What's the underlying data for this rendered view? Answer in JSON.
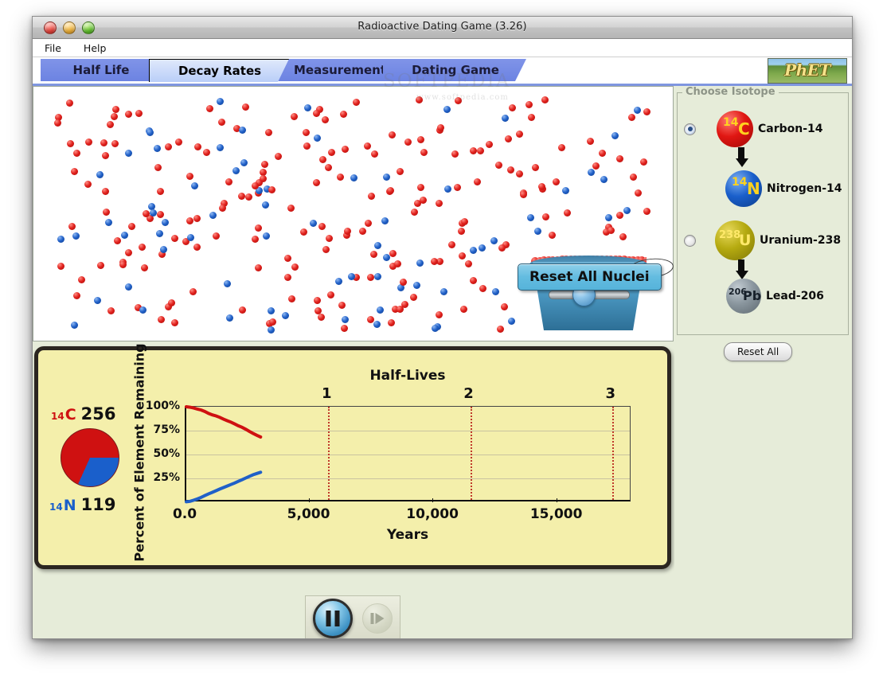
{
  "window": {
    "title": "Radioactive Dating Game (3.26)",
    "traffic_lights": [
      "close-red",
      "minimize-yellow",
      "zoom-green"
    ]
  },
  "menubar": {
    "items": [
      "File",
      "Help"
    ]
  },
  "tabs": [
    {
      "label": "Half Life",
      "active": false
    },
    {
      "label": "Decay Rates",
      "active": true
    },
    {
      "label": "Measurement",
      "active": false
    },
    {
      "label": "Dating Game",
      "active": false
    }
  ],
  "logo": {
    "text": "PhET"
  },
  "watermark": {
    "text": "SOFTPEDIA",
    "sub": "www.softpedia.com"
  },
  "canvas": {
    "reset_nuclei_label": "Reset All Nuclei",
    "bucket_name": "nuclei-bucket"
  },
  "isotope_panel": {
    "legend": "Choose Isotope",
    "options": [
      {
        "selected": true,
        "parent": {
          "mass": "14",
          "symbol": "C",
          "label": "Carbon-14",
          "color": "#e01612"
        },
        "daughter": {
          "mass": "14",
          "symbol": "N",
          "label": "Nitrogen-14",
          "color": "#1a5fcb"
        }
      },
      {
        "selected": false,
        "parent": {
          "mass": "238",
          "symbol": "U",
          "label": "Uranium-238",
          "color": "#b5aa10"
        },
        "daughter": {
          "mass": "206",
          "symbol": "Pb",
          "label": "Lead-206",
          "color": "#8b979f"
        }
      }
    ],
    "reset_all_label": "Reset All"
  },
  "counts": {
    "parent": {
      "mass": "14",
      "symbol": "C",
      "value": "256"
    },
    "daughter": {
      "mass": "14",
      "symbol": "N",
      "value": "119"
    }
  },
  "controls": {
    "play_pause": "pause",
    "step": "step-forward",
    "step_enabled": false
  },
  "chart_data": {
    "type": "line",
    "title": "Half-Lives",
    "xlabel": "Years",
    "ylabel": "Percent of Element Remaining",
    "xlim": [
      0,
      18000
    ],
    "ylim": [
      0,
      100
    ],
    "xticks": [
      0,
      5000,
      10000,
      15000
    ],
    "xticklabels": [
      "0.0",
      "5,000",
      "10,000",
      "15,000"
    ],
    "yticks": [
      25,
      50,
      75,
      100
    ],
    "yticklabels": [
      "25%",
      "50%",
      "75%",
      "100%"
    ],
    "grid": true,
    "legend": "none",
    "half_life_years": 5730,
    "half_life_markers": [
      {
        "label": "1",
        "years": 5730
      },
      {
        "label": "2",
        "years": 11460
      },
      {
        "label": "3",
        "years": 17190
      }
    ],
    "series": [
      {
        "name": "Carbon-14",
        "color": "#cf1111",
        "x": [
          0,
          150,
          300,
          450,
          600,
          750,
          900,
          1050,
          1200,
          1350,
          1500,
          1650,
          1800,
          1950,
          2100,
          2250,
          2400,
          2550,
          2700,
          2850,
          3000
        ],
        "y": [
          100,
          99.5,
          98.7,
          97.5,
          96.6,
          95.0,
          93.0,
          91.5,
          90.4,
          88.9,
          87.0,
          85.4,
          83.9,
          82.0,
          80.1,
          78.5,
          76.4,
          74.2,
          72.0,
          70.1,
          68.3
        ]
      },
      {
        "name": "Nitrogen-14",
        "color": "#2060c8",
        "x": [
          0,
          150,
          300,
          450,
          600,
          750,
          900,
          1050,
          1200,
          1350,
          1500,
          1650,
          1800,
          1950,
          2100,
          2250,
          2400,
          2550,
          2700,
          2850,
          3000
        ],
        "y": [
          0.5,
          1.0,
          2.2,
          3.6,
          5.2,
          7.0,
          8.8,
          10.4,
          12.1,
          13.8,
          15.4,
          17.0,
          18.6,
          20.2,
          21.9,
          23.6,
          25.4,
          27.2,
          28.8,
          30.2,
          31.4
        ]
      }
    ],
    "pie": {
      "type": "pie",
      "slices": [
        {
          "name": "Carbon-14",
          "value": 256,
          "color": "#cf1111"
        },
        {
          "name": "Nitrogen-14",
          "value": 119,
          "color": "#1a5fcb"
        }
      ]
    }
  }
}
